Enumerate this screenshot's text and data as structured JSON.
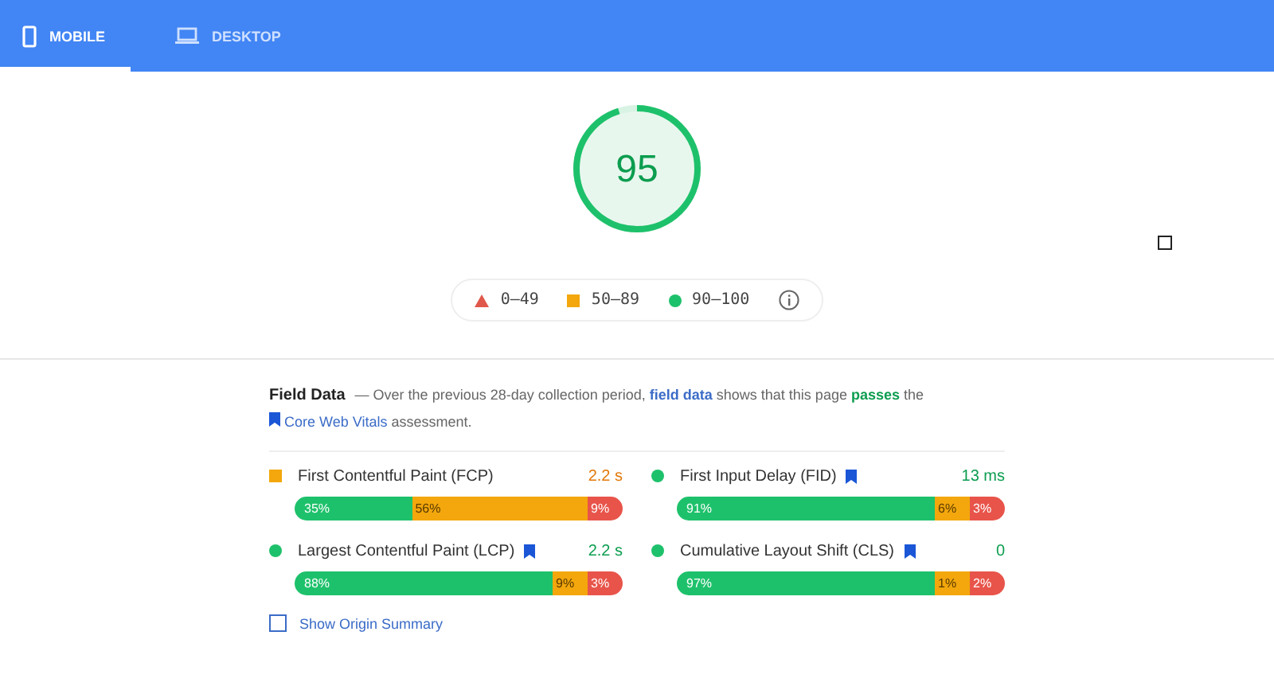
{
  "tabs": [
    {
      "label": "MOBILE",
      "kind": "mobile",
      "selected": true
    },
    {
      "label": "DESKTOP",
      "kind": "desktop",
      "selected": false
    }
  ],
  "score": {
    "value": "95",
    "level": 0.95
  },
  "legend": [
    {
      "label": "0–49",
      "kind": "triangle",
      "color": "#e0584b"
    },
    {
      "label": "50–89",
      "kind": "square",
      "color": "#f3a70c"
    },
    {
      "label": "90–100",
      "kind": "circle",
      "color": "#1ec16b"
    }
  ],
  "field_data": {
    "title": "Field Data",
    "description": "— Over the previous 28-day collection period, ",
    "link": "field data",
    "middle": " shows that this page ",
    "verdict": "passes",
    "end": " the",
    "vitals_link": "Core Web Vitals",
    "tail": " assessment."
  },
  "metrics": [
    {
      "name": "First Contentful Paint (FCP)",
      "value": "2.2 s",
      "kind": "square",
      "color": "#f3a70c",
      "core_vital": false,
      "segments": [
        {
          "label": "35%",
          "kind": "good"
        },
        {
          "label": "56%",
          "kind": "average"
        },
        {
          "label": "9%",
          "kind": "poor"
        }
      ]
    },
    {
      "name": "First Input Delay (FID)",
      "value": "13 ms",
      "kind": "circle",
      "color": "#1ec16b",
      "core_vital": true,
      "segments": [
        {
          "label": "91%",
          "kind": "good"
        },
        {
          "label": "6%",
          "kind": "average"
        },
        {
          "label": "3%",
          "kind": "poor"
        }
      ]
    },
    {
      "name": "Largest Contentful Paint (LCP)",
      "value": "2.2 s",
      "kind": "circle",
      "color": "#1ec16b",
      "core_vital": true,
      "segments": [
        {
          "label": "88%",
          "kind": "good"
        },
        {
          "label": "9%",
          "kind": "average"
        },
        {
          "label": "3%",
          "kind": "poor"
        }
      ]
    },
    {
      "name": "Cumulative Layout Shift (CLS)",
      "value": "0",
      "kind": "circle",
      "color": "#1ec16b",
      "core_vital": true,
      "segments": [
        {
          "label": "97%",
          "kind": "good"
        },
        {
          "label": "1%",
          "kind": "average"
        },
        {
          "label": "2%",
          "kind": "poor"
        }
      ]
    }
  ],
  "origin_summary": {
    "label": "Show Origin Summary",
    "checked": false
  }
}
